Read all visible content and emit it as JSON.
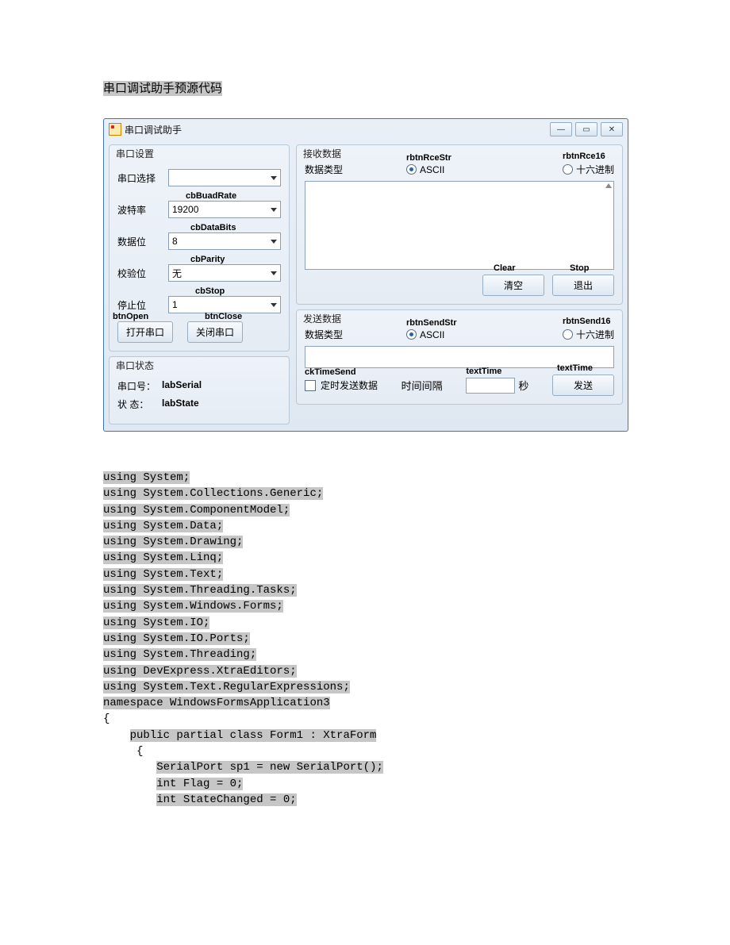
{
  "doc_title": "串口调试助手预源代码",
  "window": {
    "title": "串口调试助手",
    "min_glyph": "—",
    "max_glyph": "▭",
    "close_glyph": "✕"
  },
  "serial_settings": {
    "group_title": "串口设置",
    "port_label": "串口选择",
    "port_value": "",
    "baud_label": "波特率",
    "baud_anno": "cbBuadRate",
    "baud_value": "19200",
    "databits_label": "数据位",
    "databits_anno": "cbDataBits",
    "databits_value": "8",
    "parity_label": "校验位",
    "parity_anno": "cbParity",
    "parity_value": "无",
    "stop_label": "停止位",
    "stop_anno": "cbStop",
    "stop_value": "1",
    "btn_open_anno": "btnOpen",
    "btn_open": "打开串口",
    "btn_close_anno": "btnClose",
    "btn_close": "关闭串口"
  },
  "serial_status": {
    "group_title": "串口状态",
    "port_no_label": "串口号：",
    "port_no_anno": "labSerial",
    "state_label": "状   态：",
    "state_anno": "labState"
  },
  "rx": {
    "group_title": "接收数据",
    "type_label": "数据类型",
    "ascii_anno": "rbtnRceStr",
    "ascii_label": "ASCII",
    "hex_anno": "rbtnRce16",
    "hex_label": "十六进制",
    "clear_anno": "Clear",
    "clear_label": "清空",
    "stop_anno": "Stop",
    "stop_label": "退出"
  },
  "tx": {
    "group_title": "发送数据",
    "type_label": "数据类型",
    "ascii_anno": "rbtnSendStr",
    "ascii_label": "ASCII",
    "hex_anno": "rbtnSend16",
    "hex_label": "十六进制",
    "ck_anno": "ckTimeSend",
    "ck_label": "定时发送数据",
    "interval_label": "时间间隔",
    "time_anno": "textTime",
    "sec_label": "秒",
    "send_anno": "textTime",
    "send_label": "发送"
  },
  "code": [
    "using System;",
    "using System.Collections.Generic;",
    "using System.ComponentModel;",
    "using System.Data;",
    "using System.Drawing;",
    "using System.Linq;",
    "using System.Text;",
    "using System.Threading.Tasks;",
    "using System.Windows.Forms;",
    "using System.IO;",
    "using System.IO.Ports;",
    "using System.Threading;",
    "using DevExpress.XtraEditors;",
    "using System.Text.RegularExpressions;",
    "",
    "namespace WindowsFormsApplication3",
    "{",
    "    public partial class Form1 : XtraForm",
    "     {",
    "        SerialPort sp1 = new SerialPort();",
    "        int Flag = 0;",
    "        int StateChanged = 0;"
  ]
}
